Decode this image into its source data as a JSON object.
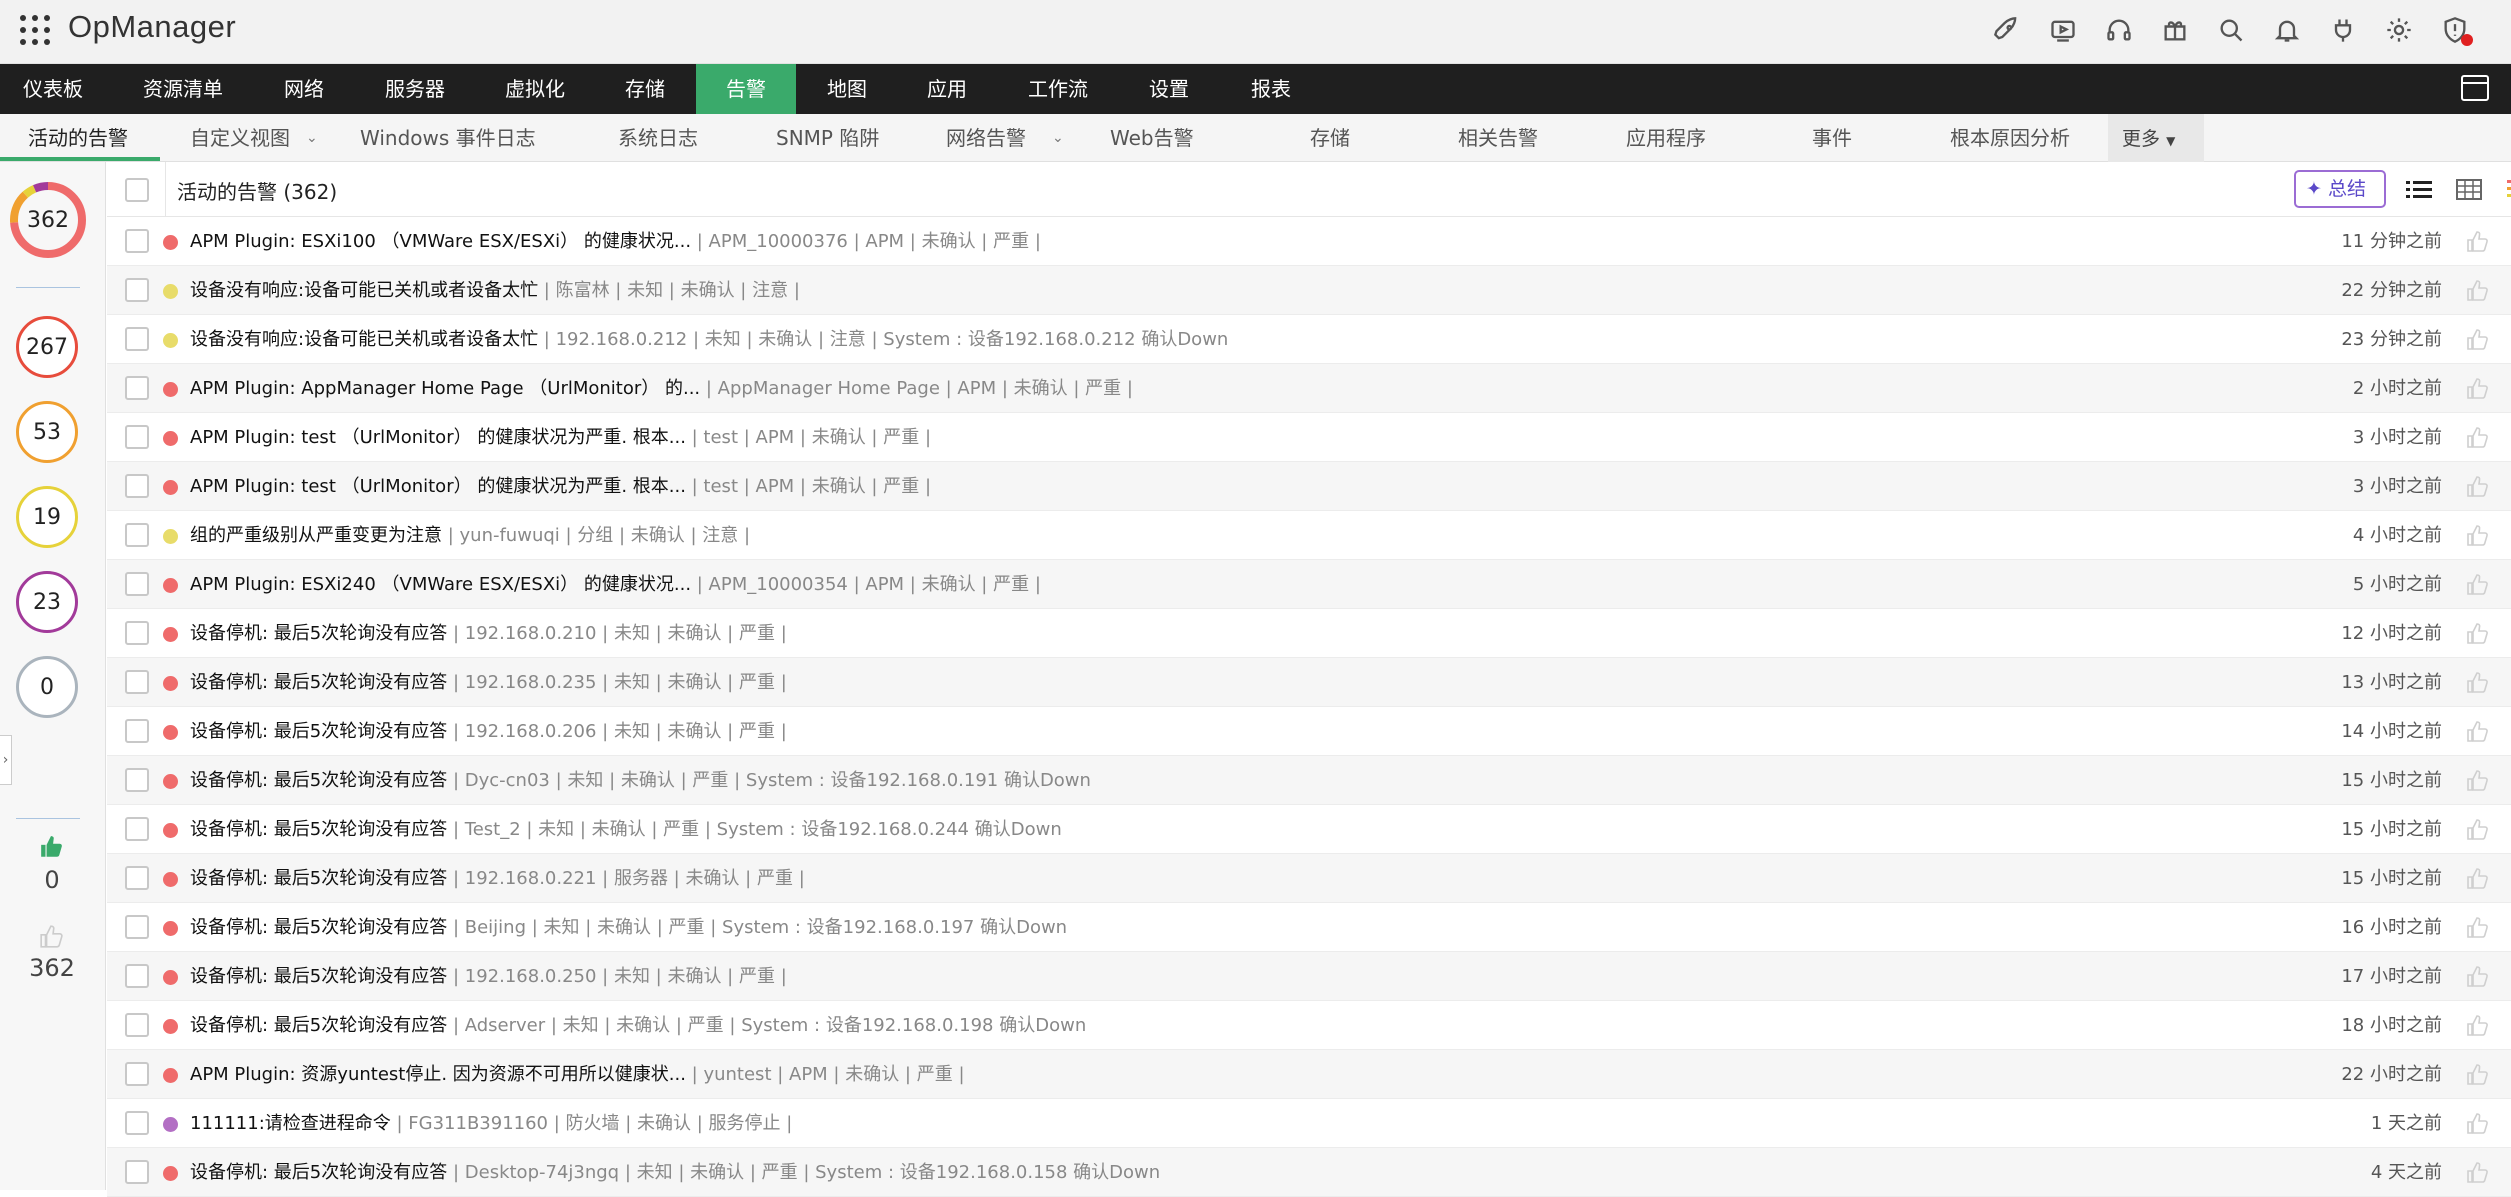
{
  "app": {
    "title": "OpManager"
  },
  "topbar": {
    "icons": [
      "rocket-icon",
      "video-icon",
      "headset-icon",
      "gift-icon",
      "search-icon",
      "bell-icon",
      "plug-icon",
      "gear-icon",
      "shield-alert-icon"
    ]
  },
  "nav": {
    "items": [
      "仪表板",
      "资源清单",
      "网络",
      "服务器",
      "虚拟化",
      "存储",
      "告警",
      "地图",
      "应用",
      "工作流",
      "设置",
      "报表"
    ],
    "active_index": 6
  },
  "subtabs": {
    "items": [
      "活动的告警",
      "自定义视图",
      "Windows 事件日志",
      "系统日志",
      "SNMP 陷阱",
      "网络告警",
      "Web告警",
      "存储",
      "相关告警",
      "应用程序",
      "事件",
      "根本原因分析"
    ],
    "more": "更多",
    "active_index": 0
  },
  "sidebar": {
    "total": "362",
    "counts": [
      {
        "value": "267",
        "color": "#e74c3c"
      },
      {
        "value": "53",
        "color": "#f0a030"
      },
      {
        "value": "19",
        "color": "#e6d23a"
      },
      {
        "value": "23",
        "color": "#a23a9a"
      },
      {
        "value": "0",
        "color": "#aab4bd"
      }
    ],
    "liked": "0",
    "unliked": "362"
  },
  "list": {
    "title": "活动的告警 (362)",
    "summary_label": "总结",
    "rows": [
      {
        "severity": "critical",
        "title": "APM Plugin: ESXi100 （VMWare ESX/ESXi） 的健康状况...",
        "meta": " | APM_10000376 | APM | 未确认 | 严重 |",
        "time": "11 分钟之前"
      },
      {
        "severity": "warning",
        "title": "设备没有响应:设备可能已关机或者设备太忙",
        "meta": " | 陈富林 | 未知 | 未确认 | 注意 |",
        "time": "22 分钟之前"
      },
      {
        "severity": "warning",
        "title": "设备没有响应:设备可能已关机或者设备太忙",
        "meta": " | 192.168.0.212 | 未知 | 未确认 | 注意 | System : 设备192.168.0.212 确认Down",
        "time": "23 分钟之前"
      },
      {
        "severity": "critical",
        "title": "APM Plugin: AppManager Home Page （UrlMonitor） 的...",
        "meta": " | AppManager Home Page | APM | 未确认 | 严重 |",
        "time": "2 小时之前"
      },
      {
        "severity": "critical",
        "title": "APM Plugin: test （UrlMonitor） 的健康状况为严重. 根本...",
        "meta": " | test | APM | 未确认 | 严重 |",
        "time": "3 小时之前"
      },
      {
        "severity": "critical",
        "title": "APM Plugin: test （UrlMonitor） 的健康状况为严重. 根本...",
        "meta": " | test | APM | 未确认 | 严重 |",
        "time": "3 小时之前"
      },
      {
        "severity": "warning",
        "title": "组的严重级别从严重变更为注意",
        "meta": " | yun-fuwuqi | 分组 | 未确认 | 注意 |",
        "time": "4 小时之前"
      },
      {
        "severity": "critical",
        "title": "APM Plugin: ESXi240 （VMWare ESX/ESXi） 的健康状况...",
        "meta": " | APM_10000354 | APM | 未确认 | 严重 |",
        "time": "5 小时之前"
      },
      {
        "severity": "critical",
        "title": "设备停机: 最后5次轮询没有应答",
        "meta": " | 192.168.0.210 | 未知 | 未确认 | 严重 |",
        "time": "12 小时之前"
      },
      {
        "severity": "critical",
        "title": "设备停机: 最后5次轮询没有应答",
        "meta": " | 192.168.0.235 | 未知 | 未确认 | 严重 |",
        "time": "13 小时之前"
      },
      {
        "severity": "critical",
        "title": "设备停机: 最后5次轮询没有应答",
        "meta": " | 192.168.0.206 | 未知 | 未确认 | 严重 |",
        "time": "14 小时之前"
      },
      {
        "severity": "critical",
        "title": "设备停机: 最后5次轮询没有应答",
        "meta": " | Dyc-cn03 | 未知 | 未确认 | 严重 | System : 设备192.168.0.191 确认Down",
        "time": "15 小时之前"
      },
      {
        "severity": "critical",
        "title": "设备停机: 最后5次轮询没有应答",
        "meta": " | Test_2 | 未知 | 未确认 | 严重 | System : 设备192.168.0.244 确认Down",
        "time": "15 小时之前"
      },
      {
        "severity": "critical",
        "title": "设备停机: 最后5次轮询没有应答",
        "meta": " | 192.168.0.221 | 服务器 | 未确认 | 严重 |",
        "time": "15 小时之前"
      },
      {
        "severity": "critical",
        "title": "设备停机: 最后5次轮询没有应答",
        "meta": " | Beijing | 未知 | 未确认 | 严重 | System : 设备192.168.0.197 确认Down",
        "time": "16 小时之前"
      },
      {
        "severity": "critical",
        "title": "设备停机: 最后5次轮询没有应答",
        "meta": " | 192.168.0.250 | 未知 | 未确认 | 严重 |",
        "time": "17 小时之前"
      },
      {
        "severity": "critical",
        "title": "设备停机: 最后5次轮询没有应答",
        "meta": " | Adserver | 未知 | 未确认 | 严重 | System : 设备192.168.0.198 确认Down",
        "time": "18 小时之前"
      },
      {
        "severity": "critical",
        "title": "APM Plugin: 资源yuntest停止. 因为资源不可用所以健康状...",
        "meta": " | yuntest | APM | 未确认 | 严重 |",
        "time": "22 小时之前"
      },
      {
        "severity": "service_down",
        "title": "111111:请检查进程命令",
        "meta": " | FG311B391160 | 防火墙 | 未确认 | 服务停止 |",
        "time": "1 天之前"
      },
      {
        "severity": "critical",
        "title": "设备停机: 最后5次轮询没有应答",
        "meta": " | Desktop-74j3ngq | 未知 | 未确认 | 严重 | System : 设备192.168.0.158 确认Down",
        "time": "4 天之前"
      }
    ]
  },
  "colors": {
    "critical": "#ef6b6b",
    "warning": "#e8dc6a",
    "service_down": "#b36fc4",
    "accent": "#3aaa6b",
    "nav_bg": "#1f1f1f"
  }
}
